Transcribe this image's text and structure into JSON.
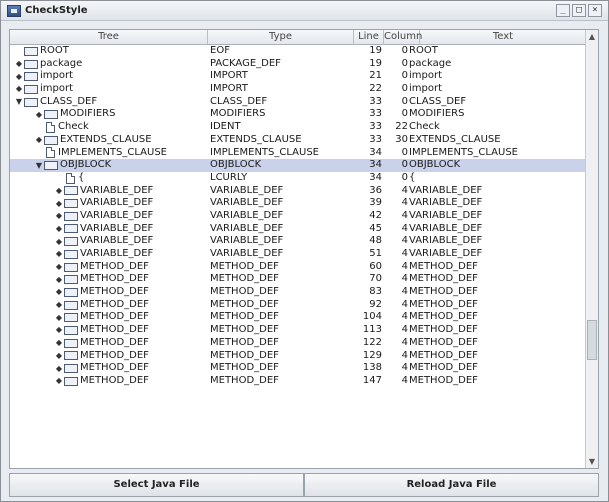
{
  "window": {
    "title": "CheckStyle",
    "controls": {
      "minimize": "_",
      "maximize": "□",
      "close": "×"
    }
  },
  "table": {
    "columns": [
      "Tree",
      "Type",
      "Line",
      "Column",
      "Text"
    ],
    "rows": [
      {
        "tree": "ROOT",
        "type": "EOF",
        "line": "19",
        "col": "0",
        "text": "ROOT",
        "indent": 0,
        "toggle": "",
        "icon": "folder"
      },
      {
        "tree": "package",
        "type": "PACKAGE_DEF",
        "line": "19",
        "col": "0",
        "text": "package",
        "indent": 0,
        "toggle": "◆",
        "icon": "folder"
      },
      {
        "tree": "import",
        "type": "IMPORT",
        "line": "21",
        "col": "0",
        "text": "import",
        "indent": 0,
        "toggle": "◆",
        "icon": "folder"
      },
      {
        "tree": "import",
        "type": "IMPORT",
        "line": "22",
        "col": "0",
        "text": "import",
        "indent": 0,
        "toggle": "◆",
        "icon": "folder"
      },
      {
        "tree": "CLASS_DEF",
        "type": "CLASS_DEF",
        "line": "33",
        "col": "0",
        "text": "CLASS_DEF",
        "indent": 0,
        "toggle": "▼",
        "icon": "folder"
      },
      {
        "tree": "MODIFIERS",
        "type": "MODIFIERS",
        "line": "33",
        "col": "0",
        "text": "MODIFIERS",
        "indent": 1,
        "toggle": "◆",
        "icon": "folder"
      },
      {
        "tree": "Check",
        "type": "IDENT",
        "line": "33",
        "col": "22",
        "text": "Check",
        "indent": 1,
        "toggle": "",
        "icon": "file"
      },
      {
        "tree": "EXTENDS_CLAUSE",
        "type": "EXTENDS_CLAUSE",
        "line": "33",
        "col": "30",
        "text": "EXTENDS_CLAUSE",
        "indent": 1,
        "toggle": "◆",
        "icon": "folder"
      },
      {
        "tree": "IMPLEMENTS_CLAUSE",
        "type": "IMPLEMENTS_CLAUSE",
        "line": "34",
        "col": "0",
        "text": "IMPLEMENTS_CLAUSE",
        "indent": 1,
        "toggle": "",
        "icon": "file"
      },
      {
        "tree": "OBJBLOCK",
        "type": "OBJBLOCK",
        "line": "34",
        "col": "0",
        "text": "OBJBLOCK",
        "indent": 1,
        "toggle": "▼",
        "icon": "folder",
        "selected": true
      },
      {
        "tree": "{",
        "type": "LCURLY",
        "line": "34",
        "col": "0",
        "text": "{",
        "indent": 2,
        "toggle": "",
        "icon": "file"
      },
      {
        "tree": "VARIABLE_DEF",
        "type": "VARIABLE_DEF",
        "line": "36",
        "col": "4",
        "text": "VARIABLE_DEF",
        "indent": 2,
        "toggle": "◆",
        "icon": "folder"
      },
      {
        "tree": "VARIABLE_DEF",
        "type": "VARIABLE_DEF",
        "line": "39",
        "col": "4",
        "text": "VARIABLE_DEF",
        "indent": 2,
        "toggle": "◆",
        "icon": "folder"
      },
      {
        "tree": "VARIABLE_DEF",
        "type": "VARIABLE_DEF",
        "line": "42",
        "col": "4",
        "text": "VARIABLE_DEF",
        "indent": 2,
        "toggle": "◆",
        "icon": "folder"
      },
      {
        "tree": "VARIABLE_DEF",
        "type": "VARIABLE_DEF",
        "line": "45",
        "col": "4",
        "text": "VARIABLE_DEF",
        "indent": 2,
        "toggle": "◆",
        "icon": "folder"
      },
      {
        "tree": "VARIABLE_DEF",
        "type": "VARIABLE_DEF",
        "line": "48",
        "col": "4",
        "text": "VARIABLE_DEF",
        "indent": 2,
        "toggle": "◆",
        "icon": "folder"
      },
      {
        "tree": "VARIABLE_DEF",
        "type": "VARIABLE_DEF",
        "line": "51",
        "col": "4",
        "text": "VARIABLE_DEF",
        "indent": 2,
        "toggle": "◆",
        "icon": "folder"
      },
      {
        "tree": "METHOD_DEF",
        "type": "METHOD_DEF",
        "line": "60",
        "col": "4",
        "text": "METHOD_DEF",
        "indent": 2,
        "toggle": "◆",
        "icon": "folder"
      },
      {
        "tree": "METHOD_DEF",
        "type": "METHOD_DEF",
        "line": "70",
        "col": "4",
        "text": "METHOD_DEF",
        "indent": 2,
        "toggle": "◆",
        "icon": "folder"
      },
      {
        "tree": "METHOD_DEF",
        "type": "METHOD_DEF",
        "line": "83",
        "col": "4",
        "text": "METHOD_DEF",
        "indent": 2,
        "toggle": "◆",
        "icon": "folder"
      },
      {
        "tree": "METHOD_DEF",
        "type": "METHOD_DEF",
        "line": "92",
        "col": "4",
        "text": "METHOD_DEF",
        "indent": 2,
        "toggle": "◆",
        "icon": "folder"
      },
      {
        "tree": "METHOD_DEF",
        "type": "METHOD_DEF",
        "line": "104",
        "col": "4",
        "text": "METHOD_DEF",
        "indent": 2,
        "toggle": "◆",
        "icon": "folder"
      },
      {
        "tree": "METHOD_DEF",
        "type": "METHOD_DEF",
        "line": "113",
        "col": "4",
        "text": "METHOD_DEF",
        "indent": 2,
        "toggle": "◆",
        "icon": "folder"
      },
      {
        "tree": "METHOD_DEF",
        "type": "METHOD_DEF",
        "line": "122",
        "col": "4",
        "text": "METHOD_DEF",
        "indent": 2,
        "toggle": "◆",
        "icon": "folder"
      },
      {
        "tree": "METHOD_DEF",
        "type": "METHOD_DEF",
        "line": "129",
        "col": "4",
        "text": "METHOD_DEF",
        "indent": 2,
        "toggle": "◆",
        "icon": "folder"
      },
      {
        "tree": "METHOD_DEF",
        "type": "METHOD_DEF",
        "line": "138",
        "col": "4",
        "text": "METHOD_DEF",
        "indent": 2,
        "toggle": "◆",
        "icon": "folder"
      },
      {
        "tree": "METHOD_DEF",
        "type": "METHOD_DEF",
        "line": "147",
        "col": "4",
        "text": "METHOD_DEF",
        "indent": 2,
        "toggle": "◆",
        "icon": "folder"
      }
    ]
  },
  "scrollbar": {
    "up_arrow": "▲",
    "down_arrow": "▼"
  },
  "footer": {
    "select_label": "Select Java File",
    "reload_label": "Reload Java File"
  }
}
